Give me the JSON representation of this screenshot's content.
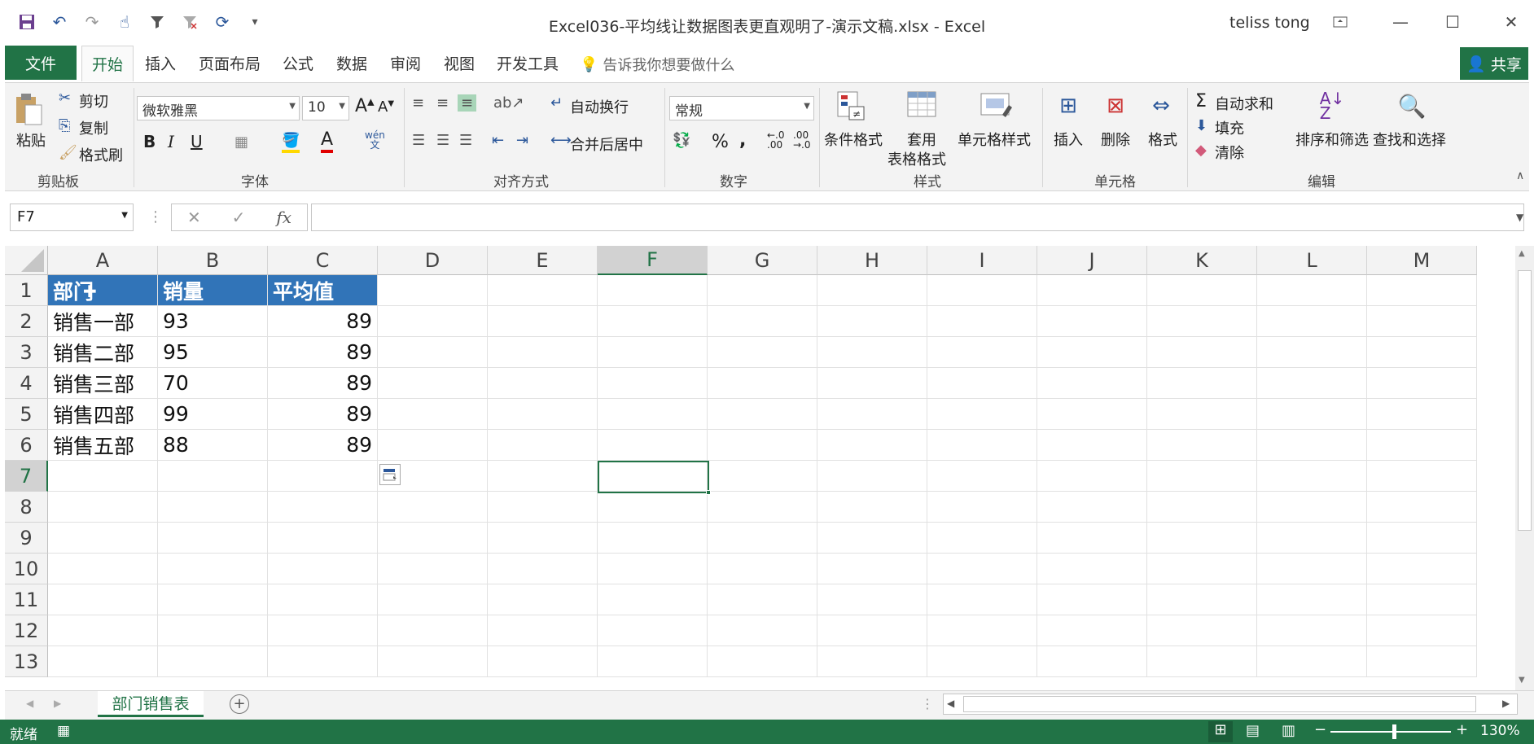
{
  "title_bar": {
    "document_title": "Excel036-平均线让数据图表更直观明了-演示文稿.xlsx  -  Excel",
    "user_name": "teliss tong"
  },
  "menu": {
    "file": "文件",
    "tabs": [
      "开始",
      "插入",
      "页面布局",
      "公式",
      "数据",
      "审阅",
      "视图",
      "开发工具"
    ],
    "tell_me": "告诉我你想要做什么",
    "share": "共享"
  },
  "ribbon": {
    "clipboard": {
      "paste": "粘贴",
      "cut": "剪切",
      "copy": "复制",
      "format_painter": "格式刷",
      "label": "剪贴板"
    },
    "font": {
      "name": "微软雅黑",
      "size": "10",
      "label": "字体",
      "phonetic": "wén"
    },
    "alignment": {
      "wrap": "自动换行",
      "merge": "合并后居中",
      "label": "对齐方式"
    },
    "number": {
      "format": "常规",
      "label": "数字"
    },
    "styles": {
      "conditional": "条件格式",
      "table_format_1": "套用",
      "table_format_2": "表格格式",
      "cell_styles": "单元格样式",
      "label": "样式"
    },
    "cells": {
      "insert": "插入",
      "delete": "删除",
      "format": "格式",
      "label": "单元格"
    },
    "editing": {
      "autosum": "自动求和",
      "fill": "填充",
      "clear": "清除",
      "sort_filter": "排序和筛选",
      "find_select": "查找和选择",
      "label": "编辑"
    }
  },
  "formula_bar": {
    "name_box": "F7",
    "fx": "fx",
    "content": ""
  },
  "grid": {
    "columns": [
      "A",
      "B",
      "C",
      "D",
      "E",
      "F",
      "G",
      "H",
      "I",
      "J",
      "K",
      "L",
      "M"
    ],
    "rows": [
      "1",
      "2",
      "3",
      "4",
      "5",
      "6",
      "7",
      "8",
      "9",
      "10",
      "11",
      "12",
      "13"
    ],
    "header": [
      "部门",
      "销量",
      "平均值"
    ],
    "data": [
      [
        "销售一部",
        "93",
        "89"
      ],
      [
        "销售二部",
        "95",
        "89"
      ],
      [
        "销售三部",
        "70",
        "89"
      ],
      [
        "销售四部",
        "99",
        "89"
      ],
      [
        "销售五部",
        "88",
        "89"
      ]
    ],
    "selected_cell": "F7"
  },
  "sheets": {
    "active": "部门销售表"
  },
  "status": {
    "ready": "就绪",
    "zoom": "130%"
  },
  "colors": {
    "accent": "#217346",
    "header_fill": "#3174b8"
  }
}
